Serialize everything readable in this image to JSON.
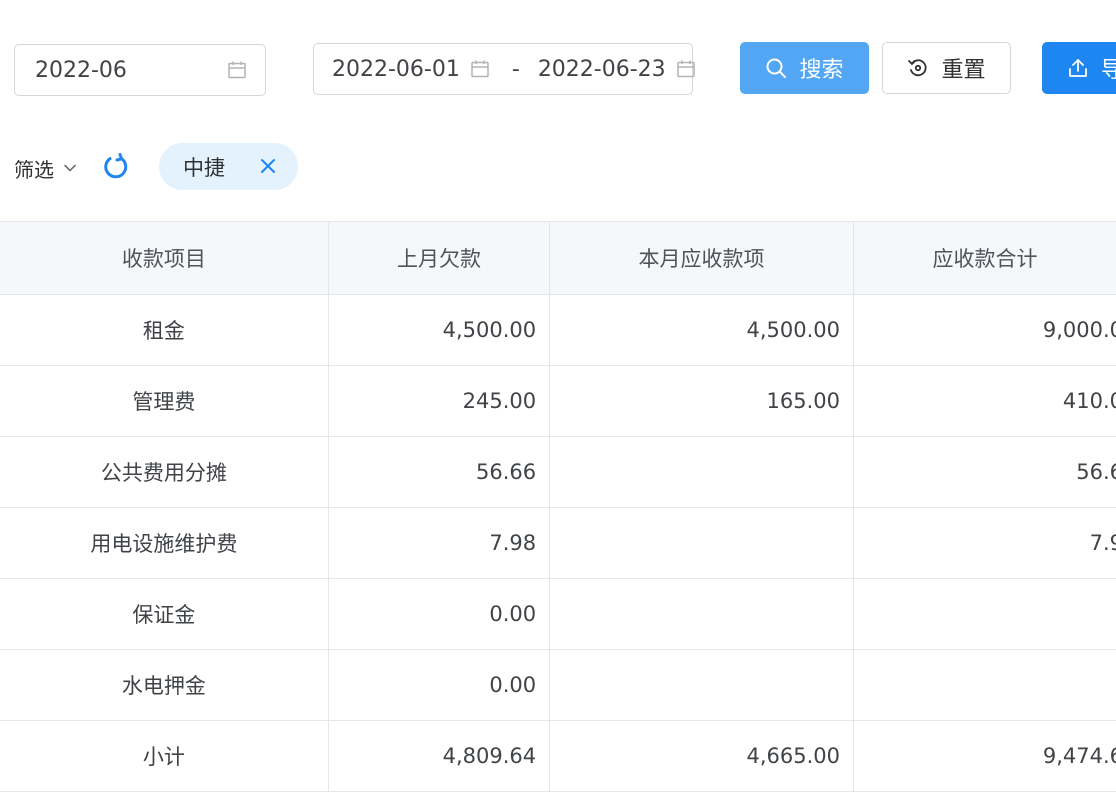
{
  "toolbar": {
    "month_value": "2022-06",
    "range_start": "2022-06-01",
    "range_separator": "-",
    "range_end": "2022-06-23",
    "search_label": "搜索",
    "reset_label": "重置",
    "export_label": "导"
  },
  "filter": {
    "toggle_label": "筛选",
    "tag_label": "中捷"
  },
  "table": {
    "headers": [
      "收款项目",
      "上月欠款",
      "本月应收款项",
      "应收款合计"
    ],
    "rows": [
      [
        "租金",
        "4,500.00",
        "4,500.00",
        "9,000.0"
      ],
      [
        "管理费",
        "245.00",
        "165.00",
        "410.0"
      ],
      [
        "公共费用分摊",
        "56.66",
        "",
        "56.6"
      ],
      [
        "用电设施维护费",
        "7.98",
        "",
        "7.9"
      ],
      [
        "保证金",
        "0.00",
        "",
        ""
      ],
      [
        "水电押金",
        "0.00",
        "",
        ""
      ],
      [
        "小计",
        "4,809.64",
        "4,665.00",
        "9,474.6"
      ]
    ]
  },
  "colors": {
    "primary": "#1e86f0",
    "primary_light": "#53a6f3",
    "tag_bg": "#e4f2fd",
    "header_bg": "#f5f7fa",
    "border": "#e4e6ea"
  },
  "icons": {
    "month_field": "calendar-icon",
    "range_start": "calendar-icon",
    "range_end": "calendar-icon",
    "search_button": "search-icon",
    "reset_button": "reset-icon",
    "export_button": "upload-icon",
    "filter_toggle": "chevron-down-icon",
    "refresh": "refresh-icon",
    "tag_close": "close-icon"
  }
}
